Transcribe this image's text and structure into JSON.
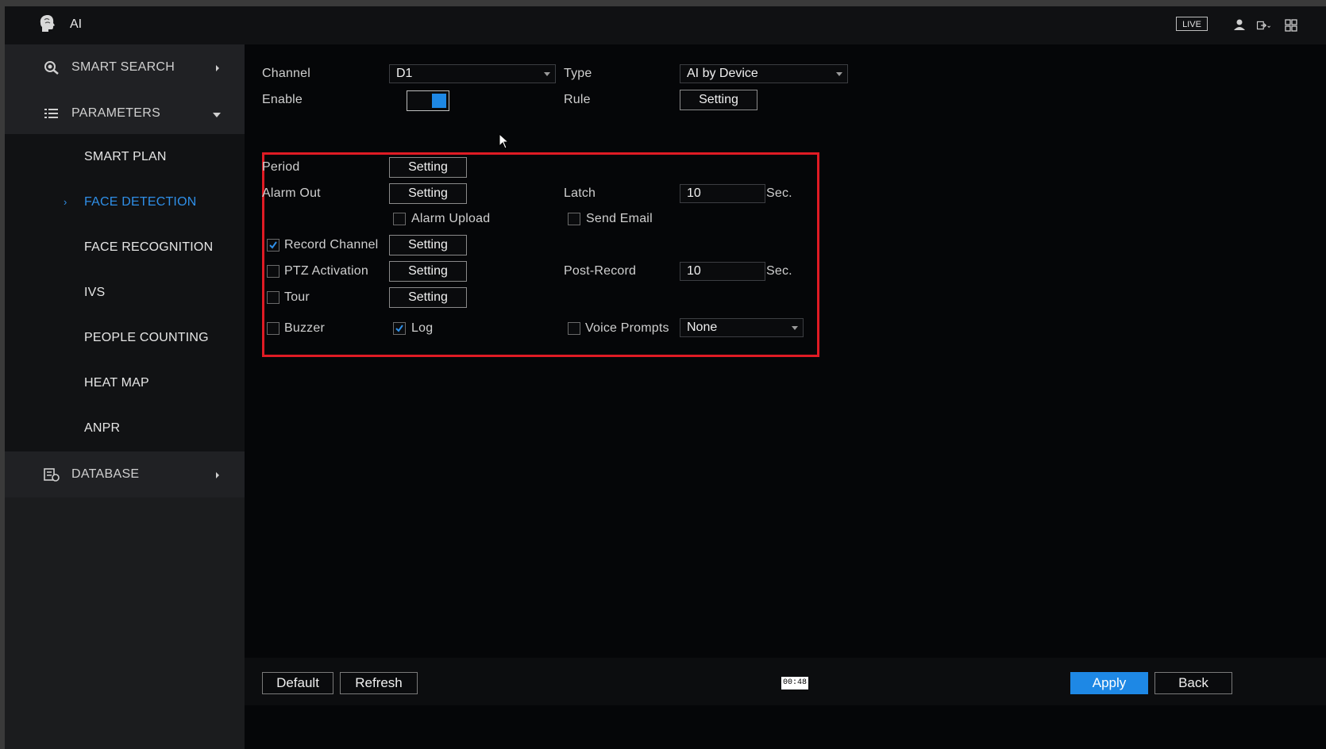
{
  "app": {
    "title": "AI",
    "live_label": "LIVE",
    "timecode": "00:48"
  },
  "icons": {
    "logo": "brain-head-icon",
    "user": "user-icon",
    "logout": "logout-icon",
    "grid": "grid-icon",
    "smart_search": "smart-search-icon",
    "parameters": "list-icon",
    "database": "database-icon"
  },
  "sidebar": {
    "smart_search": "SMART SEARCH",
    "parameters": "PARAMETERS",
    "database": "DATABASE",
    "sub_items": [
      "SMART PLAN",
      "FACE DETECTION",
      "FACE RECOGNITION",
      "IVS",
      "PEOPLE COUNTING",
      "HEAT MAP",
      "ANPR"
    ],
    "active_index": 1
  },
  "form": {
    "channel_label": "Channel",
    "channel_value": "D1",
    "type_label": "Type",
    "type_value": "AI by Device",
    "enable_label": "Enable",
    "enable_on": true,
    "rule_label": "Rule",
    "period_label": "Period",
    "alarm_out_label": "Alarm Out",
    "latch_label": "Latch",
    "latch_value": "10",
    "latch_unit": "Sec.",
    "alarm_upload_label": "Alarm Upload",
    "alarm_upload_checked": false,
    "send_email_label": "Send Email",
    "send_email_checked": false,
    "record_channel_label": "Record Channel",
    "record_channel_checked": true,
    "ptz_label": "PTZ Activation",
    "ptz_checked": false,
    "post_record_label": "Post-Record",
    "post_record_value": "10",
    "post_record_unit": "Sec.",
    "tour_label": "Tour",
    "tour_checked": false,
    "buzzer_label": "Buzzer",
    "buzzer_checked": false,
    "log_label": "Log",
    "log_checked": true,
    "voice_prompts_label": "Voice Prompts",
    "voice_prompts_checked": false,
    "voice_prompts_value": "None",
    "setting_label": "Setting"
  },
  "footer": {
    "default": "Default",
    "refresh": "Refresh",
    "apply": "Apply",
    "back": "Back"
  },
  "colors": {
    "accent": "#1e88e5",
    "highlight_border": "#e01b24",
    "active_text": "#2f8fe8"
  }
}
